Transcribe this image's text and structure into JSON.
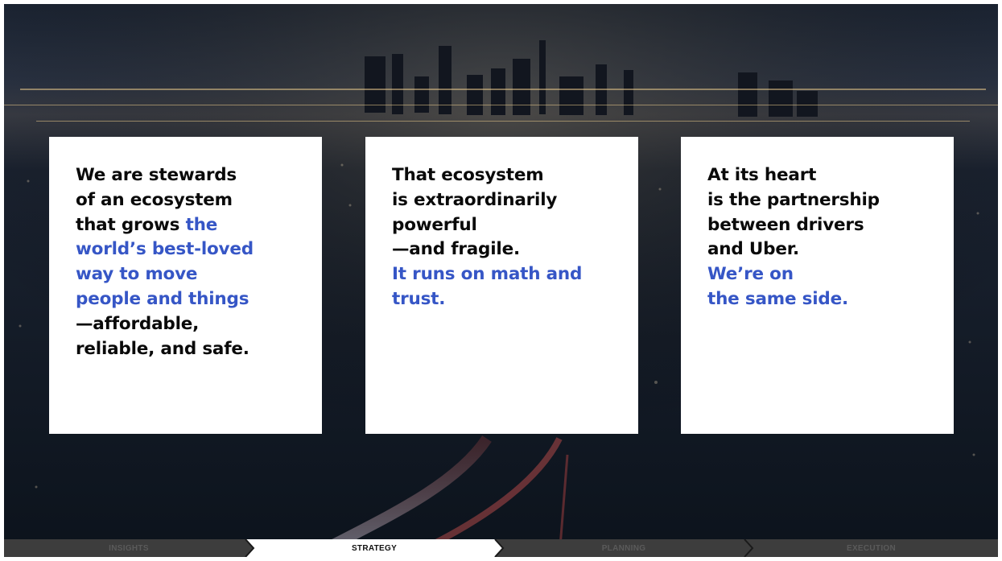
{
  "cards": [
    {
      "lines": [
        {
          "text": "We are stewards",
          "highlight": false
        },
        {
          "text": "of an ecosystem",
          "highlight": false
        },
        {
          "prefix": "that grows ",
          "text": "the",
          "highlight": true
        },
        {
          "text": "world’s best-loved",
          "highlight": true
        },
        {
          "text": "way to move",
          "highlight": true
        },
        {
          "text": "people and things",
          "highlight": true
        },
        {
          "text": "—affordable,",
          "highlight": false
        },
        {
          "text": "reliable, and safe.",
          "highlight": false
        }
      ]
    },
    {
      "lines": [
        {
          "text": "That ecosystem",
          "highlight": false
        },
        {
          "text": "is extraordinarily",
          "highlight": false
        },
        {
          "text": "powerful",
          "highlight": false
        },
        {
          "text": "—and fragile.",
          "highlight": false
        },
        {
          "text": "It runs on math and",
          "highlight": true
        },
        {
          "text": "trust.",
          "highlight": true
        }
      ]
    },
    {
      "lines": [
        {
          "text": "At its heart",
          "highlight": false
        },
        {
          "text": "is the partnership",
          "highlight": false
        },
        {
          "text": "between drivers",
          "highlight": false
        },
        {
          "text": "and Uber.",
          "highlight": false
        },
        {
          "text": "We’re on",
          "highlight": true
        },
        {
          "text": "the same side.",
          "highlight": true
        }
      ]
    }
  ],
  "nav": {
    "steps": [
      "INSIGHTS",
      "STRATEGY",
      "PLANNING",
      "EXECUTION"
    ],
    "active_index": 1
  },
  "colors": {
    "highlight": "#3656c6",
    "body_text": "#0a0a0a",
    "nav_bg": "#3d3d3d",
    "nav_active_bg": "#ffffff"
  }
}
